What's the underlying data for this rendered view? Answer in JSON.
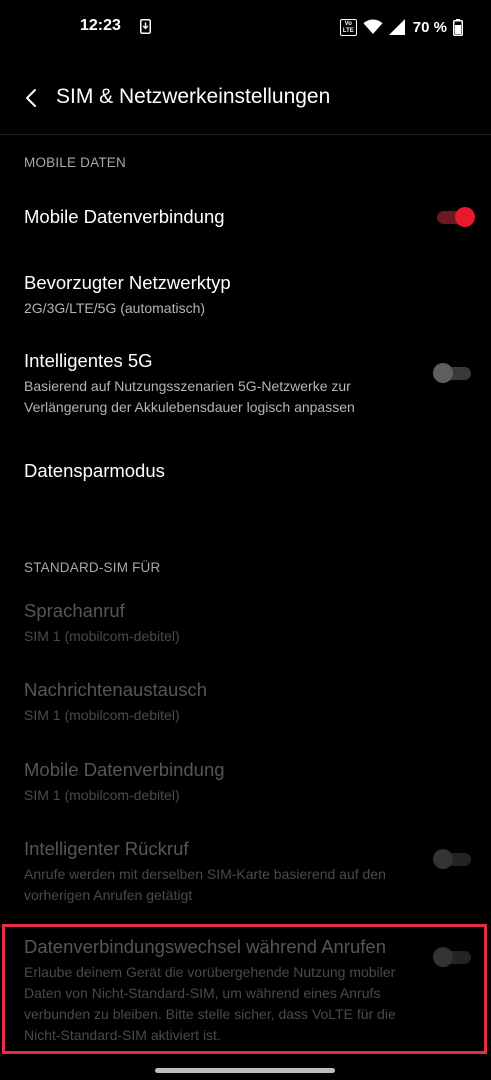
{
  "status_bar": {
    "time": "12:23",
    "download_icon": "download-icon",
    "volte_top": "Vo",
    "volte_bottom": "LTE",
    "battery_percent": "70 %"
  },
  "header": {
    "title": "SIM & Netzwerkeinstellungen",
    "back_icon": "back-arrow-icon"
  },
  "sections": {
    "mobile_data": {
      "header": "MOBILE DATEN",
      "items": [
        {
          "title": "Mobile Datenverbindung",
          "toggle": true
        },
        {
          "title": "Bevorzugter Netzwerktyp",
          "subtitle": "2G/3G/LTE/5G (automatisch)"
        },
        {
          "title": "Intelligentes 5G",
          "subtitle": "Basierend auf Nutzungsszenarien 5G-Netzwerke zur Verlängerung der Akkulebensdauer logisch anpassen",
          "toggle": false
        },
        {
          "title": "Datensparmodus"
        }
      ]
    },
    "default_sim": {
      "header": "STANDARD-SIM FÜR",
      "items": [
        {
          "title": "Sprachanruf",
          "subtitle": "SIM 1  (mobilcom-debitel)",
          "disabled": true
        },
        {
          "title": "Nachrichtenaustausch",
          "subtitle": "SIM 1  (mobilcom-debitel)",
          "disabled": true
        },
        {
          "title": "Mobile Datenverbindung",
          "subtitle": "SIM 1  (mobilcom-debitel)",
          "disabled": true
        },
        {
          "title": "Intelligenter Rückruf",
          "subtitle": "Anrufe werden mit derselben SIM-Karte basierend auf den vorherigen Anrufen getätigt",
          "toggle": false,
          "disabled": true
        },
        {
          "title": "Datenverbindungswechsel während Anrufen",
          "subtitle": "Erlaube deinem Gerät die vorübergehende Nutzung mobiler Daten von Nicht-Standard-SIM, um während eines Anrufs verbunden zu bleiben. Bitte stelle sicher, dass VoLTE für die Nicht-Standard-SIM aktiviert ist.",
          "toggle": false,
          "disabled": true
        }
      ]
    }
  },
  "colors": {
    "accent": "#e7192d",
    "highlight": "#e52e47",
    "background": "#000000"
  }
}
